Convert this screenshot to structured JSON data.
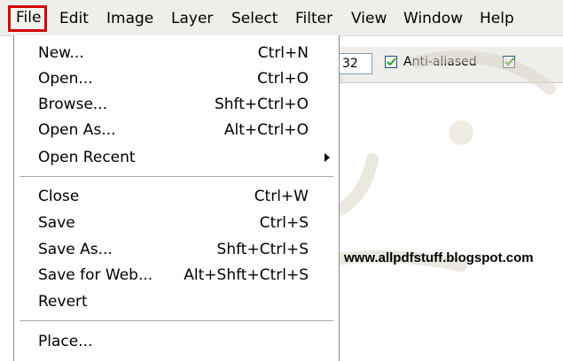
{
  "menubar": {
    "items": [
      "File",
      "Edit",
      "Image",
      "Layer",
      "Select",
      "Filter",
      "View",
      "Window",
      "Help"
    ],
    "highlight_color": "#d40000"
  },
  "toolbar": {
    "field_value": "32",
    "anti_aliased_label": "Anti-aliased",
    "anti_aliased_checked": true,
    "second_checkbox_checked": true
  },
  "file_menu": {
    "new": {
      "label": "New...",
      "shortcut": "Ctrl+N"
    },
    "open": {
      "label": "Open...",
      "shortcut": "Ctrl+O"
    },
    "browse": {
      "label": "Browse...",
      "shortcut": "Shft+Ctrl+O"
    },
    "open_as": {
      "label": "Open As...",
      "shortcut": "Alt+Ctrl+O"
    },
    "open_recent": {
      "label": "Open Recent"
    },
    "close": {
      "label": "Close",
      "shortcut": "Ctrl+W"
    },
    "save": {
      "label": "Save",
      "shortcut": "Ctrl+S"
    },
    "save_as": {
      "label": "Save As...",
      "shortcut": "Shft+Ctrl+S"
    },
    "save_for_web": {
      "label": "Save for Web...",
      "shortcut": "Alt+Shft+Ctrl+S"
    },
    "revert": {
      "label": "Revert"
    },
    "place": {
      "label": "Place..."
    }
  },
  "website": "www.allpdfstuff.blogspot.com"
}
